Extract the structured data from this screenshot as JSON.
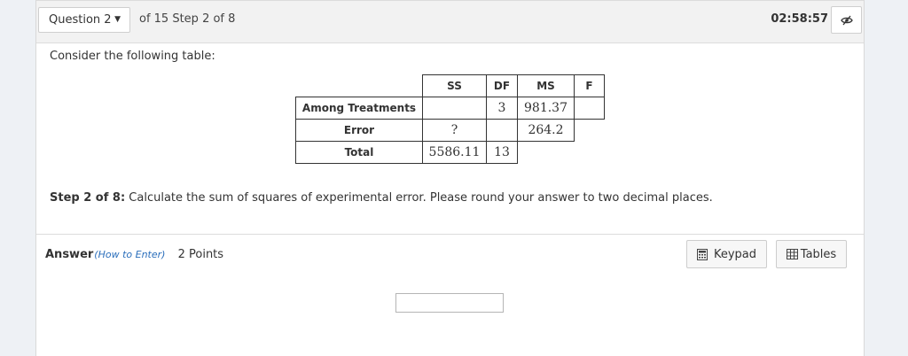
{
  "header": {
    "question_label": "Question 2",
    "progress_text": "of 15 Step 2 of 8",
    "timer": "02:58:57",
    "visibility_icon": "eye-slash-icon"
  },
  "question": {
    "prompt": "Consider the following table:",
    "table": {
      "columns": [
        "",
        "SS",
        "DF",
        "MS",
        "F"
      ],
      "rows": [
        {
          "label": "Among Treatments",
          "ss": "",
          "df": "3",
          "ms": "981.37",
          "f": ""
        },
        {
          "label": "Error",
          "ss": "?",
          "df": "",
          "ms": "264.2"
        },
        {
          "label": "Total",
          "ss": "5586.11",
          "df": "13"
        }
      ]
    },
    "step_label": "Step 2 of 8:",
    "step_text": " Calculate the sum of squares of experimental error. Please round your answer to two decimal places."
  },
  "answer": {
    "label": "Answer",
    "how_to": "(How to Enter)",
    "points": "2 Points",
    "input_value": "",
    "keypad_label": "Keypad",
    "keypad_icon": "calculator-icon",
    "tables_label": "Tables",
    "tables_icon": "table-grid-icon"
  }
}
